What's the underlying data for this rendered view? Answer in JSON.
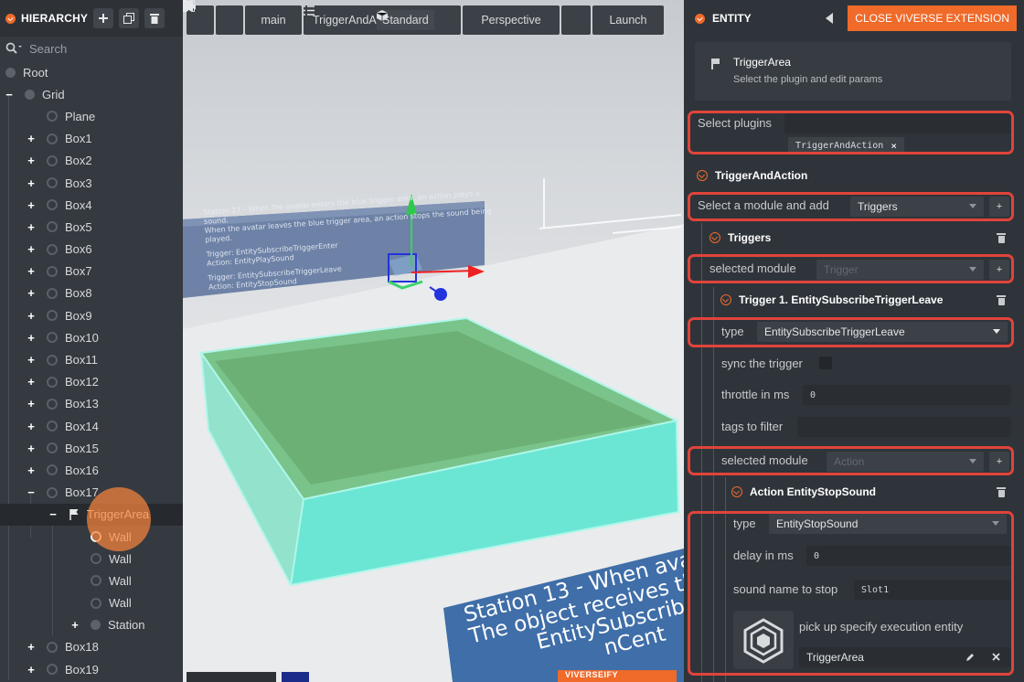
{
  "hierarchy": {
    "title": "HIERARCHY",
    "add_icon": "plus-icon",
    "duplicate_icon": "copy-icon",
    "delete_icon": "trash-icon",
    "search_placeholder": "Search",
    "tree": [
      {
        "label": "Root",
        "depth": 0,
        "expander": "",
        "icon": "node"
      },
      {
        "label": "Grid",
        "depth": 1,
        "expander": "−",
        "icon": "node"
      },
      {
        "label": "Plane",
        "depth": 2,
        "expander": "",
        "icon": "box"
      },
      {
        "label": "Box1",
        "depth": 2,
        "expander": "+",
        "icon": "box"
      },
      {
        "label": "Box2",
        "depth": 2,
        "expander": "+",
        "icon": "box"
      },
      {
        "label": "Box3",
        "depth": 2,
        "expander": "+",
        "icon": "box"
      },
      {
        "label": "Box4",
        "depth": 2,
        "expander": "+",
        "icon": "box"
      },
      {
        "label": "Box5",
        "depth": 2,
        "expander": "+",
        "icon": "box"
      },
      {
        "label": "Box6",
        "depth": 2,
        "expander": "+",
        "icon": "box"
      },
      {
        "label": "Box7",
        "depth": 2,
        "expander": "+",
        "icon": "box"
      },
      {
        "label": "Box8",
        "depth": 2,
        "expander": "+",
        "icon": "box"
      },
      {
        "label": "Box9",
        "depth": 2,
        "expander": "+",
        "icon": "box"
      },
      {
        "label": "Box10",
        "depth": 2,
        "expander": "+",
        "icon": "box"
      },
      {
        "label": "Box11",
        "depth": 2,
        "expander": "+",
        "icon": "box"
      },
      {
        "label": "Box12",
        "depth": 2,
        "expander": "+",
        "icon": "box"
      },
      {
        "label": "Box13",
        "depth": 2,
        "expander": "+",
        "icon": "box"
      },
      {
        "label": "Box14",
        "depth": 2,
        "expander": "+",
        "icon": "box"
      },
      {
        "label": "Box15",
        "depth": 2,
        "expander": "+",
        "icon": "box"
      },
      {
        "label": "Box16",
        "depth": 2,
        "expander": "+",
        "icon": "box"
      },
      {
        "label": "Box17",
        "depth": 2,
        "expander": "−",
        "icon": "box"
      },
      {
        "label": "TriggerArea",
        "depth": 3,
        "expander": "−",
        "icon": "flag",
        "selected": true
      },
      {
        "label": "Wall",
        "depth": 4,
        "expander": "",
        "icon": "box",
        "highlight": true
      },
      {
        "label": "Wall",
        "depth": 4,
        "expander": "",
        "icon": "box"
      },
      {
        "label": "Wall",
        "depth": 4,
        "expander": "",
        "icon": "box"
      },
      {
        "label": "Wall",
        "depth": 4,
        "expander": "",
        "icon": "box"
      },
      {
        "label": "Station",
        "depth": 4,
        "expander": "+",
        "icon": "node"
      },
      {
        "label": "Box18",
        "depth": 2,
        "expander": "+",
        "icon": "box"
      },
      {
        "label": "Box19",
        "depth": 2,
        "expander": "+",
        "icon": "box"
      }
    ]
  },
  "viewport": {
    "toolbar": {
      "home_icon": "home-icon",
      "settings_icon": "gear-icon",
      "branch_label": "main",
      "scene_label": "TriggerAndAction",
      "mode_label": "Standard",
      "camera_label": "Perspective",
      "fullscreen_icon": "fullscreen-icon",
      "launch_label": "Launch"
    },
    "sign_back": {
      "line1": "Station 17 - When the avatar enters the blue trigger area, an action plays a sound.",
      "line2": "When the avatar leaves the blue trigger area, an action stops the sound being played.",
      "line3": "Trigger: EntitySubscribeTriggerEnter",
      "line4": "Action: EntityPlaySound",
      "line5": "Trigger: EntitySubscribeTriggerLeave",
      "line6": "Action: EntityStopSound"
    },
    "sign_front": {
      "line1": "Station 13 - When ava",
      "line2": "The object receives the",
      "line3": "EntitySubscrib",
      "line4": "nCent"
    },
    "bottom_button": "VIVERSEIFY"
  },
  "entity": {
    "title": "ENTITY",
    "collapse_icon": "triangle-left-icon",
    "close_button": "CLOSE VIVERSE EXTENSION",
    "card": {
      "name": "TriggerArea",
      "hint": "Select the plugin and edit params"
    },
    "select_plugins_label": "Select plugins",
    "plugin_chip": "TriggerAndAction",
    "plugin_section": "TriggerAndAction",
    "module_add_label": "Select a module and add",
    "module_add_value": "Triggers",
    "triggers_section": "Triggers",
    "trigger_selected_label": "selected module",
    "trigger_selected_placeholder": "Trigger",
    "trigger1_title": "Trigger 1. EntitySubscribeTriggerLeave",
    "trigger_type_label": "type",
    "trigger_type_value": "EntitySubscribeTriggerLeave",
    "sync_label": "sync the trigger",
    "throttle_label": "throttle in ms",
    "throttle_value": "0",
    "tags_label": "tags to filter",
    "tags_value": "",
    "action_selected_label": "selected module",
    "action_selected_placeholder": "Action",
    "action_title": "Action EntityStopSound",
    "action_type_label": "type",
    "action_type_value": "EntityStopSound",
    "delay_label": "delay in ms",
    "delay_value": "0",
    "sound_label": "sound name to stop",
    "sound_value": "Slot1",
    "pick_label": "pick up specify execution entity",
    "pick_value": "TriggerArea",
    "plus": "+"
  },
  "colors": {
    "accent": "#f06a2a",
    "highlight_box": "#e0443a",
    "panel": "#2f343a"
  }
}
